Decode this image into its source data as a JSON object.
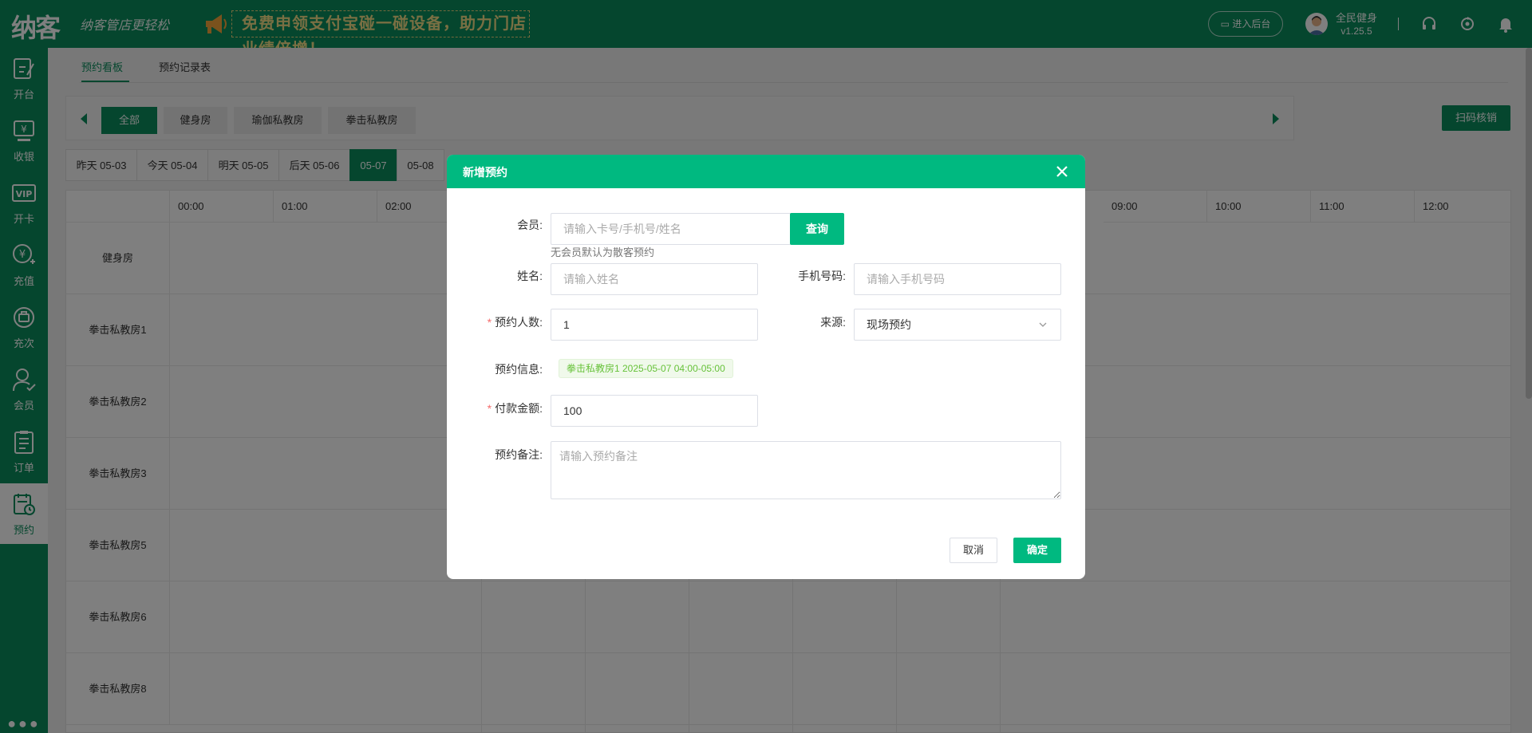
{
  "header": {
    "logo": "纳客",
    "slogan": "纳客管店更轻松",
    "banner": "免费申领支付宝碰一碰设备，助力门店业绩倍增！",
    "enter_admin": "进入后台",
    "user_name": "全民健身",
    "version": "v1.25.5",
    "icons": [
      "headset-icon",
      "refresh-icon",
      "bell-icon"
    ]
  },
  "sidebar": {
    "items": [
      {
        "label": "开台",
        "icon": "open-table-icon"
      },
      {
        "label": "收银",
        "icon": "cashier-icon"
      },
      {
        "label": "开卡",
        "icon": "vip-card-icon"
      },
      {
        "label": "充值",
        "icon": "recharge-icon"
      },
      {
        "label": "充次",
        "icon": "recharge-times-icon"
      },
      {
        "label": "会员",
        "icon": "member-icon"
      },
      {
        "label": "订单",
        "icon": "order-icon"
      },
      {
        "label": "预约",
        "icon": "booking-icon"
      }
    ],
    "active": "预约",
    "more": "更多"
  },
  "tabs": [
    {
      "label": "预约看板",
      "active": true
    },
    {
      "label": "预约记录表",
      "active": false
    }
  ],
  "rooms": [
    {
      "label": "全部",
      "active": true
    },
    {
      "label": "健身房",
      "active": false
    },
    {
      "label": "瑜伽私教房",
      "active": false
    },
    {
      "label": "拳击私教房",
      "active": false
    }
  ],
  "scan_button": "扫码核销",
  "dates": [
    {
      "label": "昨天 05-03",
      "active": false
    },
    {
      "label": "今天 05-04",
      "active": false
    },
    {
      "label": "明天 05-05",
      "active": false
    },
    {
      "label": "后天 05-06",
      "active": false
    },
    {
      "label": "05-07",
      "active": true
    },
    {
      "label": "05-08",
      "active": false
    }
  ],
  "schedule": {
    "hours_left": [
      "00:00",
      "01:00",
      "02:00"
    ],
    "hours_right": [
      "09:00",
      "10:00",
      "11:00",
      "12:00"
    ],
    "rows": [
      "健身房",
      "拳击私教房1",
      "拳击私教房2",
      "拳击私教房3",
      "拳击私教房5",
      "拳击私教房6",
      "拳击私教房8"
    ]
  },
  "modal": {
    "title": "新增预约",
    "member_label": "会员:",
    "member_placeholder": "请输入卡号/手机号/姓名",
    "query_button": "查询",
    "member_hint": "无会员默认为散客预约",
    "name_label": "姓名:",
    "name_placeholder": "请输入姓名",
    "phone_label": "手机号码:",
    "phone_placeholder": "请输入手机号码",
    "count_label": "预约人数:",
    "count_value": "1",
    "source_label": "来源:",
    "source_value": "现场预约",
    "info_label": "预约信息:",
    "info_tag": "拳击私教房1 2025-05-07 04:00-05:00",
    "amount_label": "付款金额:",
    "amount_value": "100",
    "remark_label": "预约备注:",
    "remark_placeholder": "请输入预约备注",
    "cancel": "取消",
    "confirm": "确定"
  },
  "colors": {
    "brand": "#0a8d5c",
    "modal_accent": "#00b980",
    "required": "#f56c6c",
    "tag_text": "#67c23a"
  }
}
